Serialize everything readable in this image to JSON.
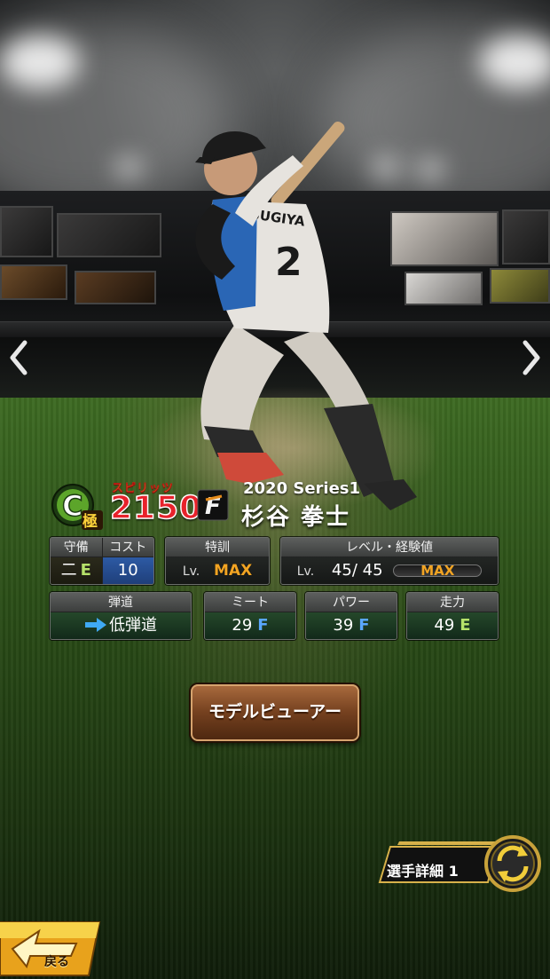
{
  "card": {
    "rank_letter": "C",
    "rank_sub": "極",
    "spirits_label": "スピリッツ",
    "spirits_value": "2150",
    "team_logo_letter": "F",
    "series": "2020 Series1",
    "player_name": "杉谷 拳士",
    "uniform_name": "SUGIYA",
    "uniform_number": "2"
  },
  "stats": {
    "defense": {
      "label": "守備",
      "position": "二",
      "grade": "E"
    },
    "cost": {
      "label": "コスト",
      "value": "10"
    },
    "training": {
      "label": "特訓",
      "lv_prefix": "Lv.",
      "value": "MAX"
    },
    "level": {
      "label": "レベル・経験値",
      "lv_prefix": "Lv.",
      "value": "45/ 45",
      "exp_label": "MAX",
      "exp_fill": 1.0
    },
    "trajectory": {
      "label": "弾道",
      "value": "低弾道"
    },
    "meet": {
      "label": "ミート",
      "value": "29",
      "grade": "F"
    },
    "power": {
      "label": "パワー",
      "value": "39",
      "grade": "F"
    },
    "speed": {
      "label": "走力",
      "value": "49",
      "grade": "E"
    }
  },
  "buttons": {
    "model_viewer": "モデルビューアー",
    "player_detail": "選手詳細 1",
    "back": "戻る"
  },
  "colors": {
    "spirits_red": "#e8222b",
    "max_orange": "#f2a423",
    "grade_f_blue": "#5aa7ff",
    "grade_e_green": "#b6e26a",
    "cost_blue": "#1f3f7a"
  },
  "icons": {
    "left": "chevron-left-icon",
    "right": "chevron-right-icon",
    "trajectory": "arrow-right-icon",
    "cycle": "cycle-icon",
    "back": "back-arrow-icon"
  }
}
